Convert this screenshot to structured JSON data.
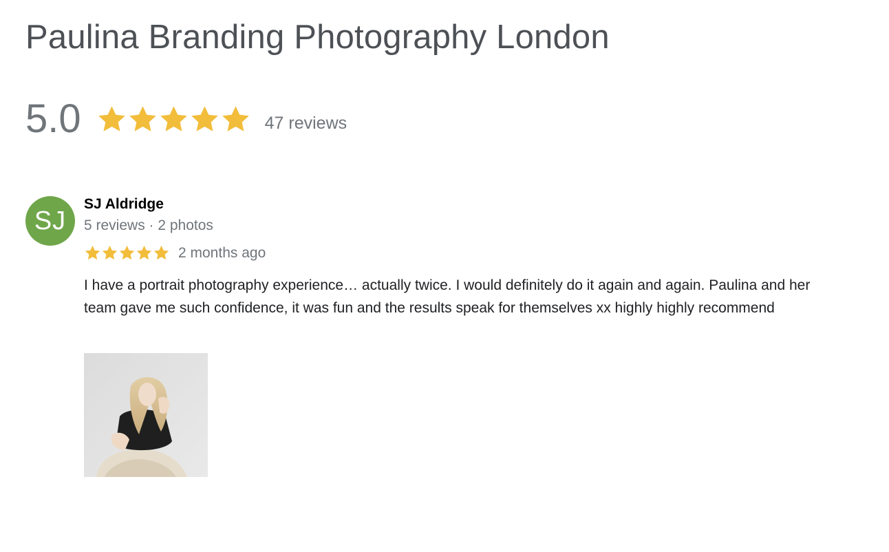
{
  "business": {
    "name": "Paulina Branding Photography London"
  },
  "summary": {
    "score": "5.0",
    "star_rating": 5,
    "star_max": 5,
    "review_count_label": "47 reviews",
    "star_color": "#f2bd3b"
  },
  "review": {
    "author": "SJ Aldridge",
    "avatar_initials": "SJ",
    "avatar_color": "#6fa64a",
    "author_meta": "5 reviews · 2 photos",
    "star_rating": 5,
    "date": "2 months ago",
    "text": "I have a portrait photography experience… actually twice. I would definitely do it again and again. Paulina and her team gave me such confidence, it was fun and the results speak for themselves xx highly highly recommend",
    "photo_icon": "review-photo"
  }
}
